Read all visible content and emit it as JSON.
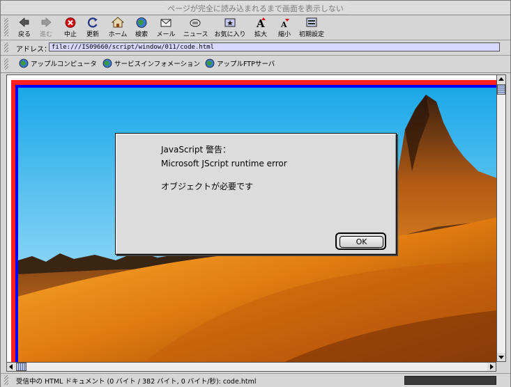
{
  "window": {
    "title": "ページが完全に読み込まれるまで画面を表示しない"
  },
  "toolbar": {
    "buttons": [
      {
        "label": "戻る",
        "icon": "back-arrow-icon"
      },
      {
        "label": "進む",
        "icon": "forward-arrow-icon"
      },
      {
        "label": "中止",
        "icon": "stop-icon"
      },
      {
        "label": "更新",
        "icon": "refresh-icon"
      },
      {
        "label": "ホーム",
        "icon": "home-icon"
      },
      {
        "label": "検索",
        "icon": "search-globe-icon"
      },
      {
        "label": "メール",
        "icon": "mail-icon"
      },
      {
        "label": "ニュース",
        "icon": "news-icon"
      },
      {
        "label": "お気に入り",
        "icon": "favorites-icon"
      },
      {
        "label": "拡大",
        "icon": "text-larger-icon"
      },
      {
        "label": "縮小",
        "icon": "text-smaller-icon"
      },
      {
        "label": "初期設定",
        "icon": "preferences-icon"
      }
    ]
  },
  "address": {
    "label": "アドレス：",
    "url": "file:///IS09660/script/window/011/code.html"
  },
  "favorites": [
    {
      "label": "アップルコンピュータ"
    },
    {
      "label": "サービスインフォメーション"
    },
    {
      "label": "アップルFTPサーバ"
    }
  ],
  "dialog": {
    "title": "JavaScript 警告：",
    "error": "Microsoft JScript runtime error",
    "message": "オブジェクトが必要です",
    "ok_label": "OK"
  },
  "status": {
    "text": "受信中の HTML ドキュメント (0 バイト / 382 バイト, 0 バイト/秒): code.html"
  },
  "colors": {
    "frame_outer": "#ff2020",
    "frame_inner": "#0000ff",
    "address_bg": "#d8d8ff"
  }
}
